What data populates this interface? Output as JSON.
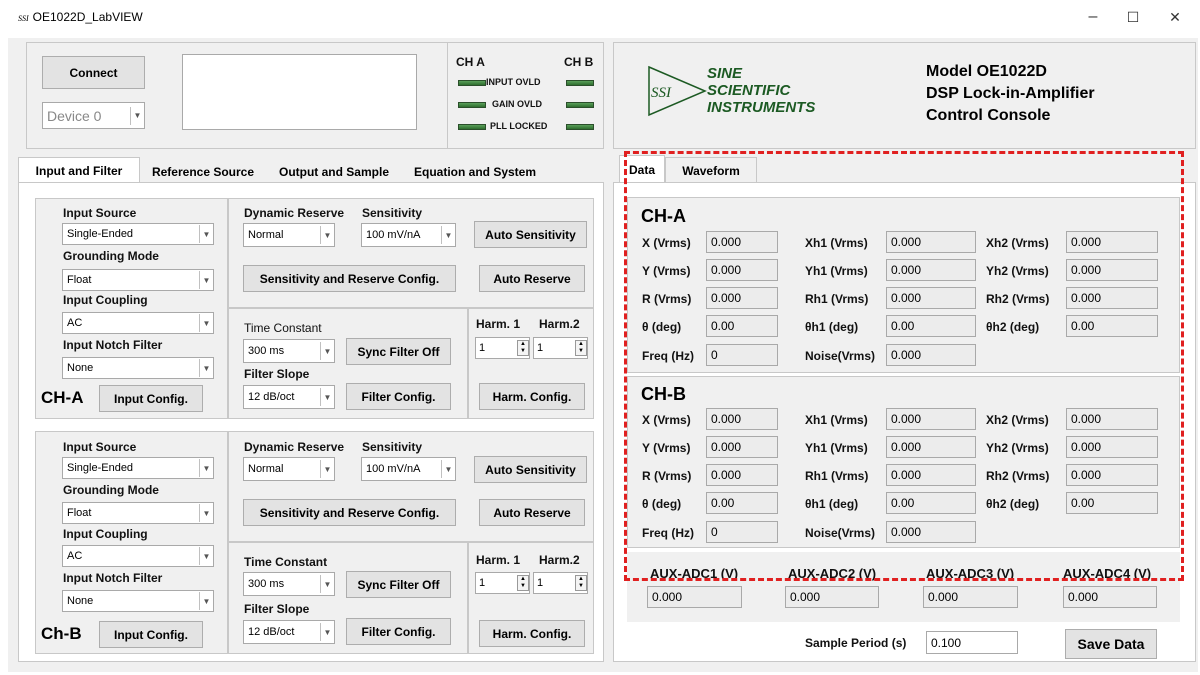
{
  "window": {
    "ssi": "SSI",
    "title": "OE1022D_LabVIEW",
    "minimize": "–",
    "maximize": "☐",
    "close": "✕"
  },
  "top": {
    "connect_label": "Connect",
    "device_value": "Device 0",
    "ch_a": "CH A",
    "ch_b": "CH B",
    "led_labels": [
      "INPUT OVLD",
      "GAIN OVLD",
      "PLL LOCKED"
    ]
  },
  "header": {
    "logo_mark": "SSI",
    "logo_lines": [
      "SINE",
      "SCIENTIFIC",
      "INSTRUMENTS"
    ],
    "model_lines": [
      "Model OE1022D",
      "DSP Lock-in-Amplifier",
      "Control Console"
    ]
  },
  "left_tabs": [
    "Input and Filter",
    "Reference Source",
    "Output and Sample",
    "Equation and System"
  ],
  "channels": [
    {
      "name": "CH-A",
      "input_source_label": "Input Source",
      "input_source": "Single-Ended",
      "grounding_label": "Grounding Mode",
      "grounding": "Float",
      "coupling_label": "Input Coupling",
      "coupling": "AC",
      "notch_label": "Input Notch Filter",
      "notch": "None",
      "input_config": "Input Config.",
      "dyn_reserve_label": "Dynamic Reserve",
      "dyn_reserve": "Normal",
      "sensitivity_label": "Sensitivity",
      "sensitivity": "100 mV/nA",
      "auto_sensitivity": "Auto Sensitivity",
      "sens_reserve_config": "Sensitivity and Reserve Config.",
      "auto_reserve": "Auto Reserve",
      "time_constant_label": "Time Constant",
      "time_constant": "300 ms",
      "sync_filter": "Sync Filter Off",
      "filter_slope_label": "Filter Slope",
      "filter_slope": "12 dB/oct",
      "filter_config": "Filter Config.",
      "harm1_label": "Harm. 1",
      "harm1": "1",
      "harm2_label": "Harm.2",
      "harm2": "1",
      "harm_config": "Harm.  Config."
    },
    {
      "name": "Ch-B",
      "input_source_label": "Input Source",
      "input_source": "Single-Ended",
      "grounding_label": "Grounding Mode",
      "grounding": "Float",
      "coupling_label": "Input Coupling",
      "coupling": "AC",
      "notch_label": "Input Notch Filter",
      "notch": "None",
      "input_config": "Input Config.",
      "dyn_reserve_label": "Dynamic Reserve",
      "dyn_reserve": "Normal",
      "sensitivity_label": "Sensitivity",
      "sensitivity": "100 mV/nA",
      "auto_sensitivity": "Auto Sensitivity",
      "sens_reserve_config": "Sensitivity and Reserve Config.",
      "auto_reserve": "Auto Reserve",
      "time_constant_label": "Time Constant",
      "time_constant": "300 ms",
      "sync_filter": "Sync Filter Off",
      "filter_slope_label": "Filter Slope",
      "filter_slope": "12 dB/oct",
      "filter_config": "Filter Config.",
      "harm1_label": "Harm. 1",
      "harm1": "1",
      "harm2_label": "Harm.2",
      "harm2": "1",
      "harm_config": "Harm.  Config."
    }
  ],
  "right_tabs": [
    "Data",
    "Waveform"
  ],
  "data_channels": [
    {
      "name": "CH-A",
      "rows": [
        [
          {
            "label": "X (Vrms)",
            "value": "0.000"
          },
          {
            "label": "Xh1 (Vrms)",
            "value": "0.000"
          },
          {
            "label": "Xh2 (Vrms)",
            "value": "0.000"
          }
        ],
        [
          {
            "label": "Y (Vrms)",
            "value": "0.000"
          },
          {
            "label": "Yh1 (Vrms)",
            "value": "0.000"
          },
          {
            "label": "Yh2 (Vrms)",
            "value": "0.000"
          }
        ],
        [
          {
            "label": "R (Vrms)",
            "value": "0.000"
          },
          {
            "label": "Rh1 (Vrms)",
            "value": "0.000"
          },
          {
            "label": "Rh2 (Vrms)",
            "value": "0.000"
          }
        ],
        [
          {
            "label": "θ  (deg)",
            "value": "0.00"
          },
          {
            "label": "θh1  (deg)",
            "value": "0.00"
          },
          {
            "label": "θh2  (deg)",
            "value": "0.00"
          }
        ]
      ],
      "freq_label": "Freq (Hz)",
      "freq": "0",
      "noise_label": "Noise(Vrms)",
      "noise": "0.000"
    },
    {
      "name": "CH-B",
      "rows": [
        [
          {
            "label": "X (Vrms)",
            "value": "0.000"
          },
          {
            "label": "Xh1 (Vrms)",
            "value": "0.000"
          },
          {
            "label": "Xh2 (Vrms)",
            "value": "0.000"
          }
        ],
        [
          {
            "label": "Y (Vrms)",
            "value": "0.000"
          },
          {
            "label": "Yh1 (Vrms)",
            "value": "0.000"
          },
          {
            "label": "Yh2 (Vrms)",
            "value": "0.000"
          }
        ],
        [
          {
            "label": "R (Vrms)",
            "value": "0.000"
          },
          {
            "label": "Rh1 (Vrms)",
            "value": "0.000"
          },
          {
            "label": "Rh2 (Vrms)",
            "value": "0.000"
          }
        ],
        [
          {
            "label": "θ  (deg)",
            "value": "0.00"
          },
          {
            "label": "θh1  (deg)",
            "value": "0.00"
          },
          {
            "label": "θh2  (deg)",
            "value": "0.00"
          }
        ]
      ],
      "freq_label": "Freq (Hz)",
      "freq": "0",
      "noise_label": "Noise(Vrms)",
      "noise": "0.000"
    }
  ],
  "aux": [
    {
      "label": "AUX-ADC1 (V)",
      "value": "0.000"
    },
    {
      "label": "AUX-ADC2 (V)",
      "value": "0.000"
    },
    {
      "label": "AUX-ADC3 (V)",
      "value": "0.000"
    },
    {
      "label": "AUX-ADC4 (V)",
      "value": "0.000"
    }
  ],
  "sample_period_label": "Sample Period (s)",
  "sample_period": "0.100",
  "save_data": "Save Data",
  "colors": {
    "highlight_dash": "#e02020",
    "led": "#3f8a3f",
    "logo": "#1c5a23"
  }
}
